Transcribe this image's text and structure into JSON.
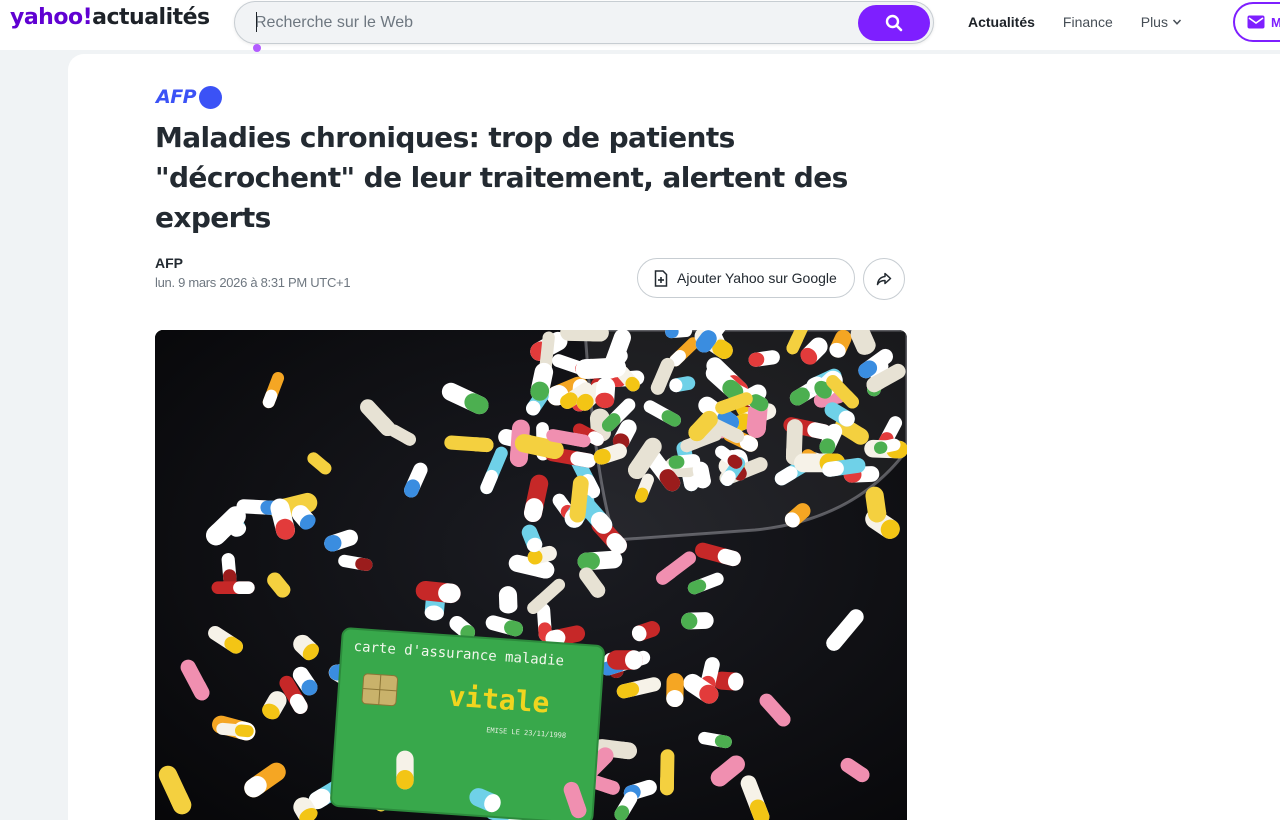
{
  "header": {
    "logo_brand": "yahoo!",
    "logo_section": "actualités",
    "search_placeholder": "Recherche sur le Web",
    "nav": [
      {
        "label": "Actualités",
        "active": true
      },
      {
        "label": "Finance",
        "active": false
      },
      {
        "label": "Plus",
        "active": false
      }
    ],
    "mail_label": "M"
  },
  "article": {
    "source_logo": "AFP",
    "title": "Maladies chroniques: trop de patients \"décrochent\" de leur traitement, alertent des experts",
    "author": "AFP",
    "timestamp": "lun. 9 mars 2026 à 8:31 PM UTC+1",
    "add_google_label": "Ajouter Yahoo sur Google",
    "image": {
      "card_line1": "carte d'assurance maladie",
      "card_line2": "vitale",
      "card_small_text": "EMISE LE 23/11/1998"
    }
  },
  "colors": {
    "brand_purple": "#7e1fff",
    "afp_blue": "#3b52f6",
    "card_green": "#35a84a"
  }
}
